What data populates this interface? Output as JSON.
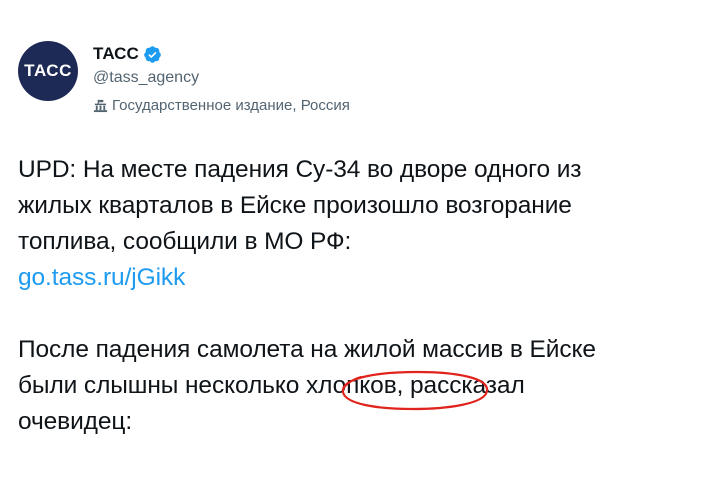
{
  "account": {
    "avatar_text": "ТАСС",
    "display_name": "ТАСС",
    "handle": "@tass_agency",
    "label": "Государственное издание, Россия",
    "verified_icon": "verified-badge-icon",
    "label_icon": "government-building-icon"
  },
  "tweet": {
    "para1_line1": "UPD: На месте падения Су-34 во дворе одного из",
    "para1_line2": "жилых кварталов в Ейске произошло возгорание",
    "para1_line3": "топлива, сообщили в МО РФ:",
    "link": "go.tass.ru/jGikk",
    "para2_line1": "После падения самолета на жилой массив в Ейске",
    "para2_line2_a": "были слышны несколько хлопков,",
    "para2_line2_b": " рассказал",
    "para2_line3": "очевидец:"
  },
  "colors": {
    "link": "#1d9bf0",
    "verified": "#1d9bf0",
    "avatar_bg": "#1d2a55",
    "annotation": "#e0231c",
    "secondary_text": "#536471"
  }
}
